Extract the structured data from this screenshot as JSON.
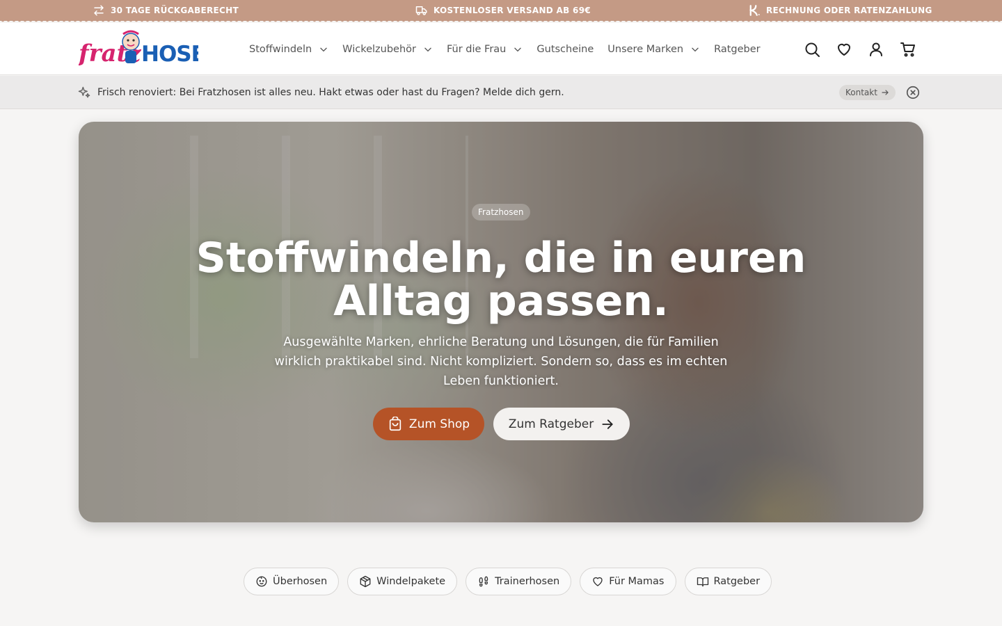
{
  "promo": {
    "returns": "30 TAGE RÜCKGABERECHT",
    "shipping": "KOSTENLOSER VERSAND AB 69€",
    "payment": "RECHNUNG ODER RATENZAHLUNG"
  },
  "logo": {
    "part1": "fratz",
    "part2": "HOSEN"
  },
  "nav": [
    {
      "label": "Stoffwindeln",
      "has_dropdown": true
    },
    {
      "label": "Wickelzubehör",
      "has_dropdown": true
    },
    {
      "label": "Für die Frau",
      "has_dropdown": true
    },
    {
      "label": "Gutscheine",
      "has_dropdown": false
    },
    {
      "label": "Unsere Marken",
      "has_dropdown": true
    },
    {
      "label": "Ratgeber",
      "has_dropdown": false
    }
  ],
  "header_icons": [
    "search-icon",
    "heart-icon",
    "user-icon",
    "cart-icon"
  ],
  "notice": {
    "text": "Frisch renoviert: Bei Fratzhosen ist alles neu. Hakt etwas oder hast du Fragen? Melde dich gern.",
    "button": "Kontakt"
  },
  "hero": {
    "badge": "Fratzhosen",
    "title": "Stoffwindeln, die in euren Alltag passen.",
    "text": "Ausgewählte Marken, ehrliche Beratung und Lösungen, die für Familien wirklich praktikabel sind. Nicht kompliziert. Sondern so, dass es im echten Leben funktioniert.",
    "shop_button": "Zum Shop",
    "guide_button": "Zum Ratgeber"
  },
  "categories": [
    {
      "label": "Überhosen",
      "icon": "baby-face-icon"
    },
    {
      "label": "Windelpakete",
      "icon": "package-icon"
    },
    {
      "label": "Trainerhosen",
      "icon": "footprints-icon"
    },
    {
      "label": "Für Mamas",
      "icon": "heart-icon"
    },
    {
      "label": "Ratgeber",
      "icon": "book-icon"
    }
  ],
  "colors": {
    "topbar": "#c49a85",
    "accent": "#b55327",
    "logo_pink": "#d6246e",
    "logo_blue": "#1a5fb4"
  }
}
